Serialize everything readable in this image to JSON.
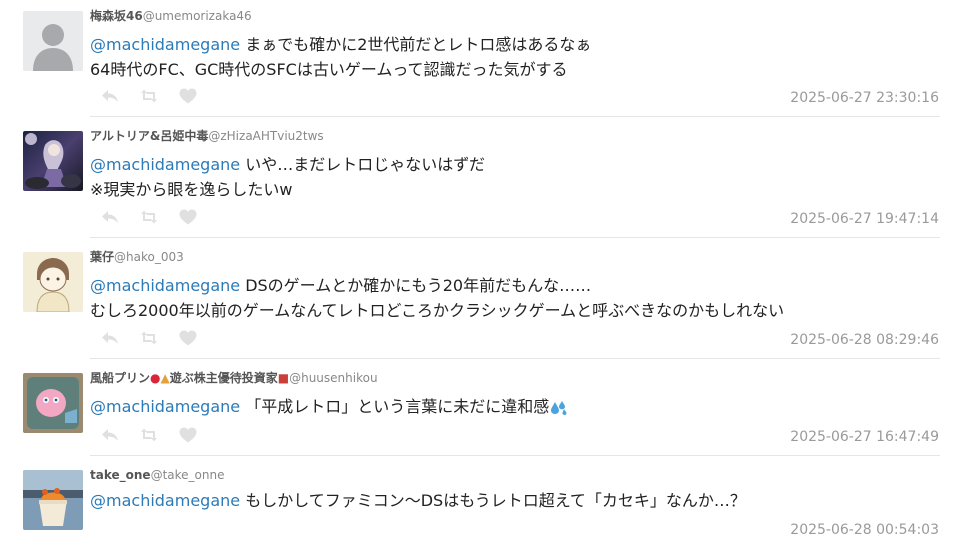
{
  "tweets": [
    {
      "display_name": "梅森坂46",
      "screen_name": "@umemorizaka46",
      "mention": "@machidamegane",
      "line1": " まぁでも確かに2世代前だとレトロ感はあるなぁ",
      "line2": "64時代のFC、GC時代のSFCは古いゲームって認識だった気がする",
      "timestamp": "2025-06-27 23:30:16",
      "avatar": "default-user-icon"
    },
    {
      "display_name": "アルトリア&呂姫中毒",
      "screen_name": "@zHizaAHTviu2tws",
      "mention": "@machidamegane",
      "line1": " いや…まだレトロじゃないはずだ",
      "line2": "※現実から眼を逸らしたいw",
      "timestamp": "2025-06-27 19:47:14",
      "avatar": "anime-character-avatar"
    },
    {
      "display_name": "葉仔",
      "screen_name": "@hako_003",
      "mention": "@machidamegane",
      "line1": " DSのゲームとか確かにもう20年前だもんな……",
      "line2": "むしろ2000年以前のゲームなんてレトロどころかクラシックゲームと呼ぶべきなのかもしれない",
      "timestamp": "2025-06-28 08:29:46",
      "avatar": "drawn-character-avatar"
    },
    {
      "display_name": "風船プリン",
      "screen_name": "@huusenhikou",
      "name_suffix": "遊ぶ株主優待投資家",
      "mention": "@machidamegane",
      "line1": " 「平成レトロ」という言葉に未だに違和感",
      "line2": "",
      "timestamp": "2025-06-27 16:47:49",
      "avatar": "pink-character-avatar"
    },
    {
      "display_name": "take_one",
      "screen_name": "@take_onne",
      "mention": "@machidamegane",
      "line1": " もしかしてファミコン〜DSはもうレトロ超えて「カセキ」なんか…？",
      "line2": "",
      "timestamp": "2025-06-28 00:54:03",
      "avatar": "dessert-photo-avatar"
    }
  ],
  "colors": {
    "mention": "#2b7bb9",
    "action_icons": "#e0e0e0",
    "timestamp": "#9a9a9a",
    "divider": "#e6e6e6"
  },
  "icons": {
    "reply": "reply-icon",
    "retweet": "retweet-icon",
    "like": "heart-icon"
  }
}
